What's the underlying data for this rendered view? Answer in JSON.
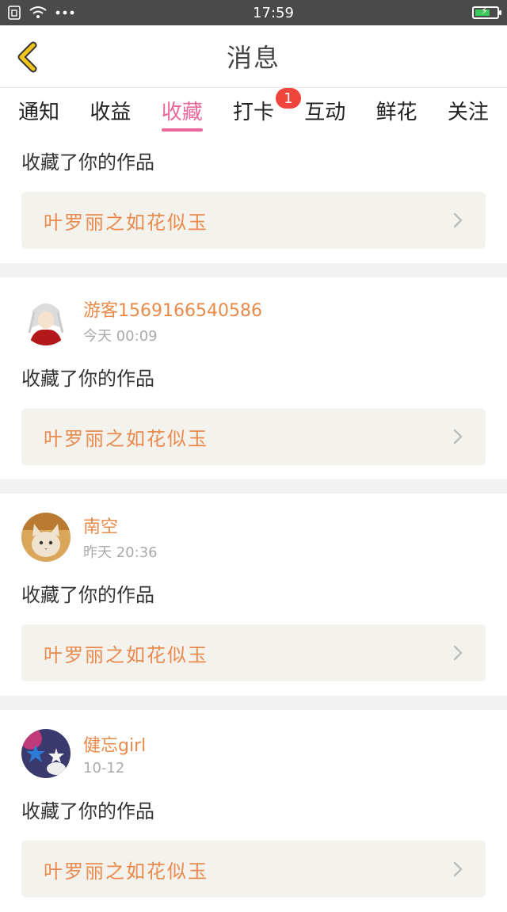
{
  "status_bar": {
    "time": "17:59"
  },
  "header": {
    "title": "消息"
  },
  "tabs": [
    {
      "label": "通知"
    },
    {
      "label": "收益"
    },
    {
      "label": "收藏"
    },
    {
      "label": "打卡",
      "badge": "1"
    },
    {
      "label": "互动"
    },
    {
      "label": "鲜花"
    },
    {
      "label": "关注"
    }
  ],
  "active_tab": "收藏",
  "items": [
    {
      "action": "收藏了你的作品",
      "work_title": "叶罗丽之如花似玉"
    },
    {
      "username": "游客1569166540586",
      "time": "今天 00:09",
      "action": "收藏了你的作品",
      "work_title": "叶罗丽之如花似玉"
    },
    {
      "username": "南空",
      "time": "昨天 20:36",
      "action": "收藏了你的作品",
      "work_title": "叶罗丽之如花似玉"
    },
    {
      "username": "健忘girl",
      "time": "10-12",
      "action": "收藏了你的作品",
      "work_title": "叶罗丽之如花似玉"
    }
  ],
  "colors": {
    "accent": "#e9679a",
    "username": "#e98a4a",
    "badge": "#f0453c",
    "back_arrow": "#f0c419"
  }
}
